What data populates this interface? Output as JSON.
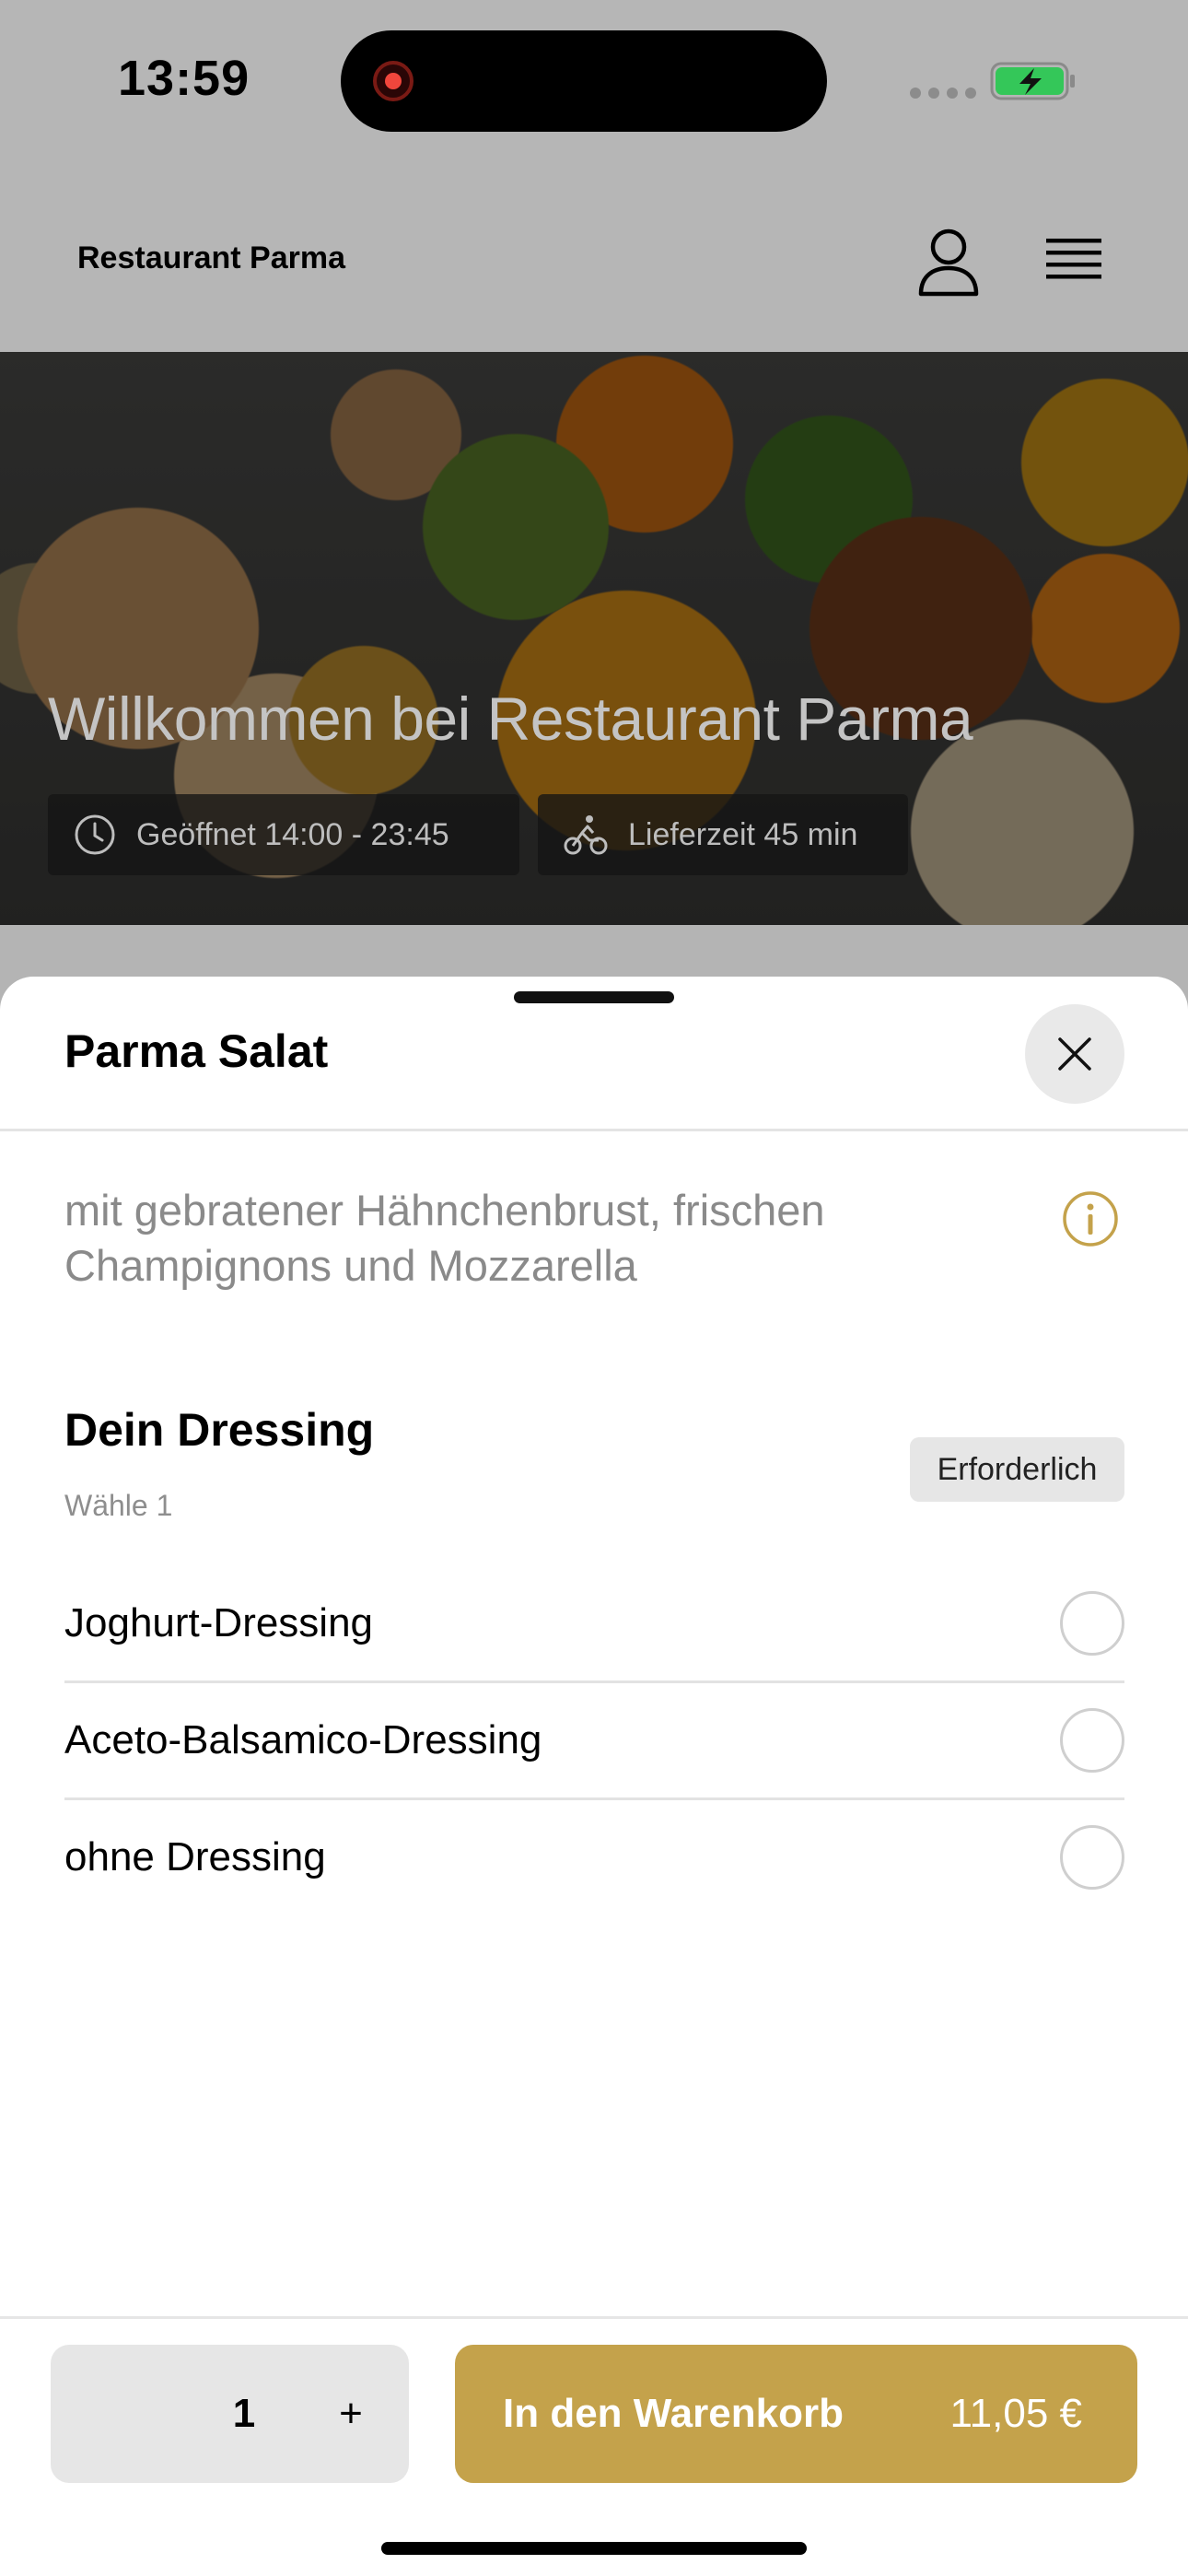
{
  "status_bar": {
    "time": "13:59"
  },
  "header": {
    "brand": "Restaurant Parma",
    "icons": [
      "profile-icon",
      "hamburger-menu-icon"
    ]
  },
  "hero": {
    "title": "Willkommen bei Restaurant Parma",
    "opening_hours": "Geöffnet 14:00 - 23:45",
    "delivery_time": "Lieferzeit 45 min",
    "icons": [
      "clock-icon",
      "cyclist-icon"
    ]
  },
  "sheet": {
    "title": "Parma Salat",
    "description": "mit gebratener Hähnchenbrust, frischen Champignons und Mozzarella",
    "group": {
      "title": "Dein Dressing",
      "subtitle": "Wähle 1",
      "badge": "Erforderlich",
      "options": [
        {
          "label": "Joghurt-Dressing",
          "selected": false
        },
        {
          "label": "Aceto-Balsamico-Dressing",
          "selected": false
        },
        {
          "label": "ohne Dressing",
          "selected": false
        }
      ]
    }
  },
  "actions": {
    "quantity": "1",
    "plus_label": "+",
    "add_to_cart_label": "In den Warenkorb",
    "price": "11,05 €"
  },
  "colors": {
    "accent": "#C4A24B",
    "overlay": "#B4B4B4",
    "battery_green": "#34C759"
  }
}
